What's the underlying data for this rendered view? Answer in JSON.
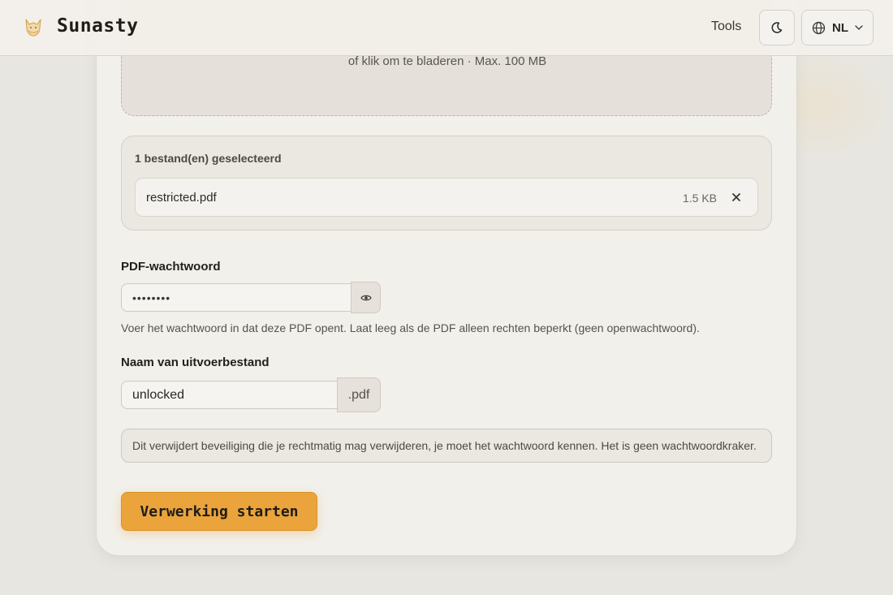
{
  "header": {
    "brand": "Sunasty",
    "nav_tools": "Tools",
    "theme_icon": "moon-icon",
    "language": "NL",
    "language_icon": "globe-icon"
  },
  "upload": {
    "subtitle": "of klik om te bladeren · Max. 100 MB"
  },
  "files": {
    "count_label": "1 bestand(en) geselecteerd",
    "items": [
      {
        "name": "restricted.pdf",
        "size": "1.5 KB"
      }
    ],
    "remove_symbol": "×"
  },
  "password": {
    "label": "PDF-wachtwoord",
    "value": "••••••••",
    "hint": "Voer het wachtwoord in dat deze PDF opent. Laat leeg als de PDF alleen rechten beperkt (geen openwachtwoord)."
  },
  "output": {
    "label": "Naam van uitvoerbestand",
    "value": "unlocked",
    "suffix": ".pdf"
  },
  "notice": "Dit verwijdert beveiliging die je rechtmatig mag verwijderen, je moet het wachtwoord kennen. Het is geen wachtwoordkraker.",
  "start_button": "Verwerking starten",
  "colors": {
    "accent": "#eaa43b",
    "background": "#e8e6e1",
    "card": "#f2f0eb"
  }
}
